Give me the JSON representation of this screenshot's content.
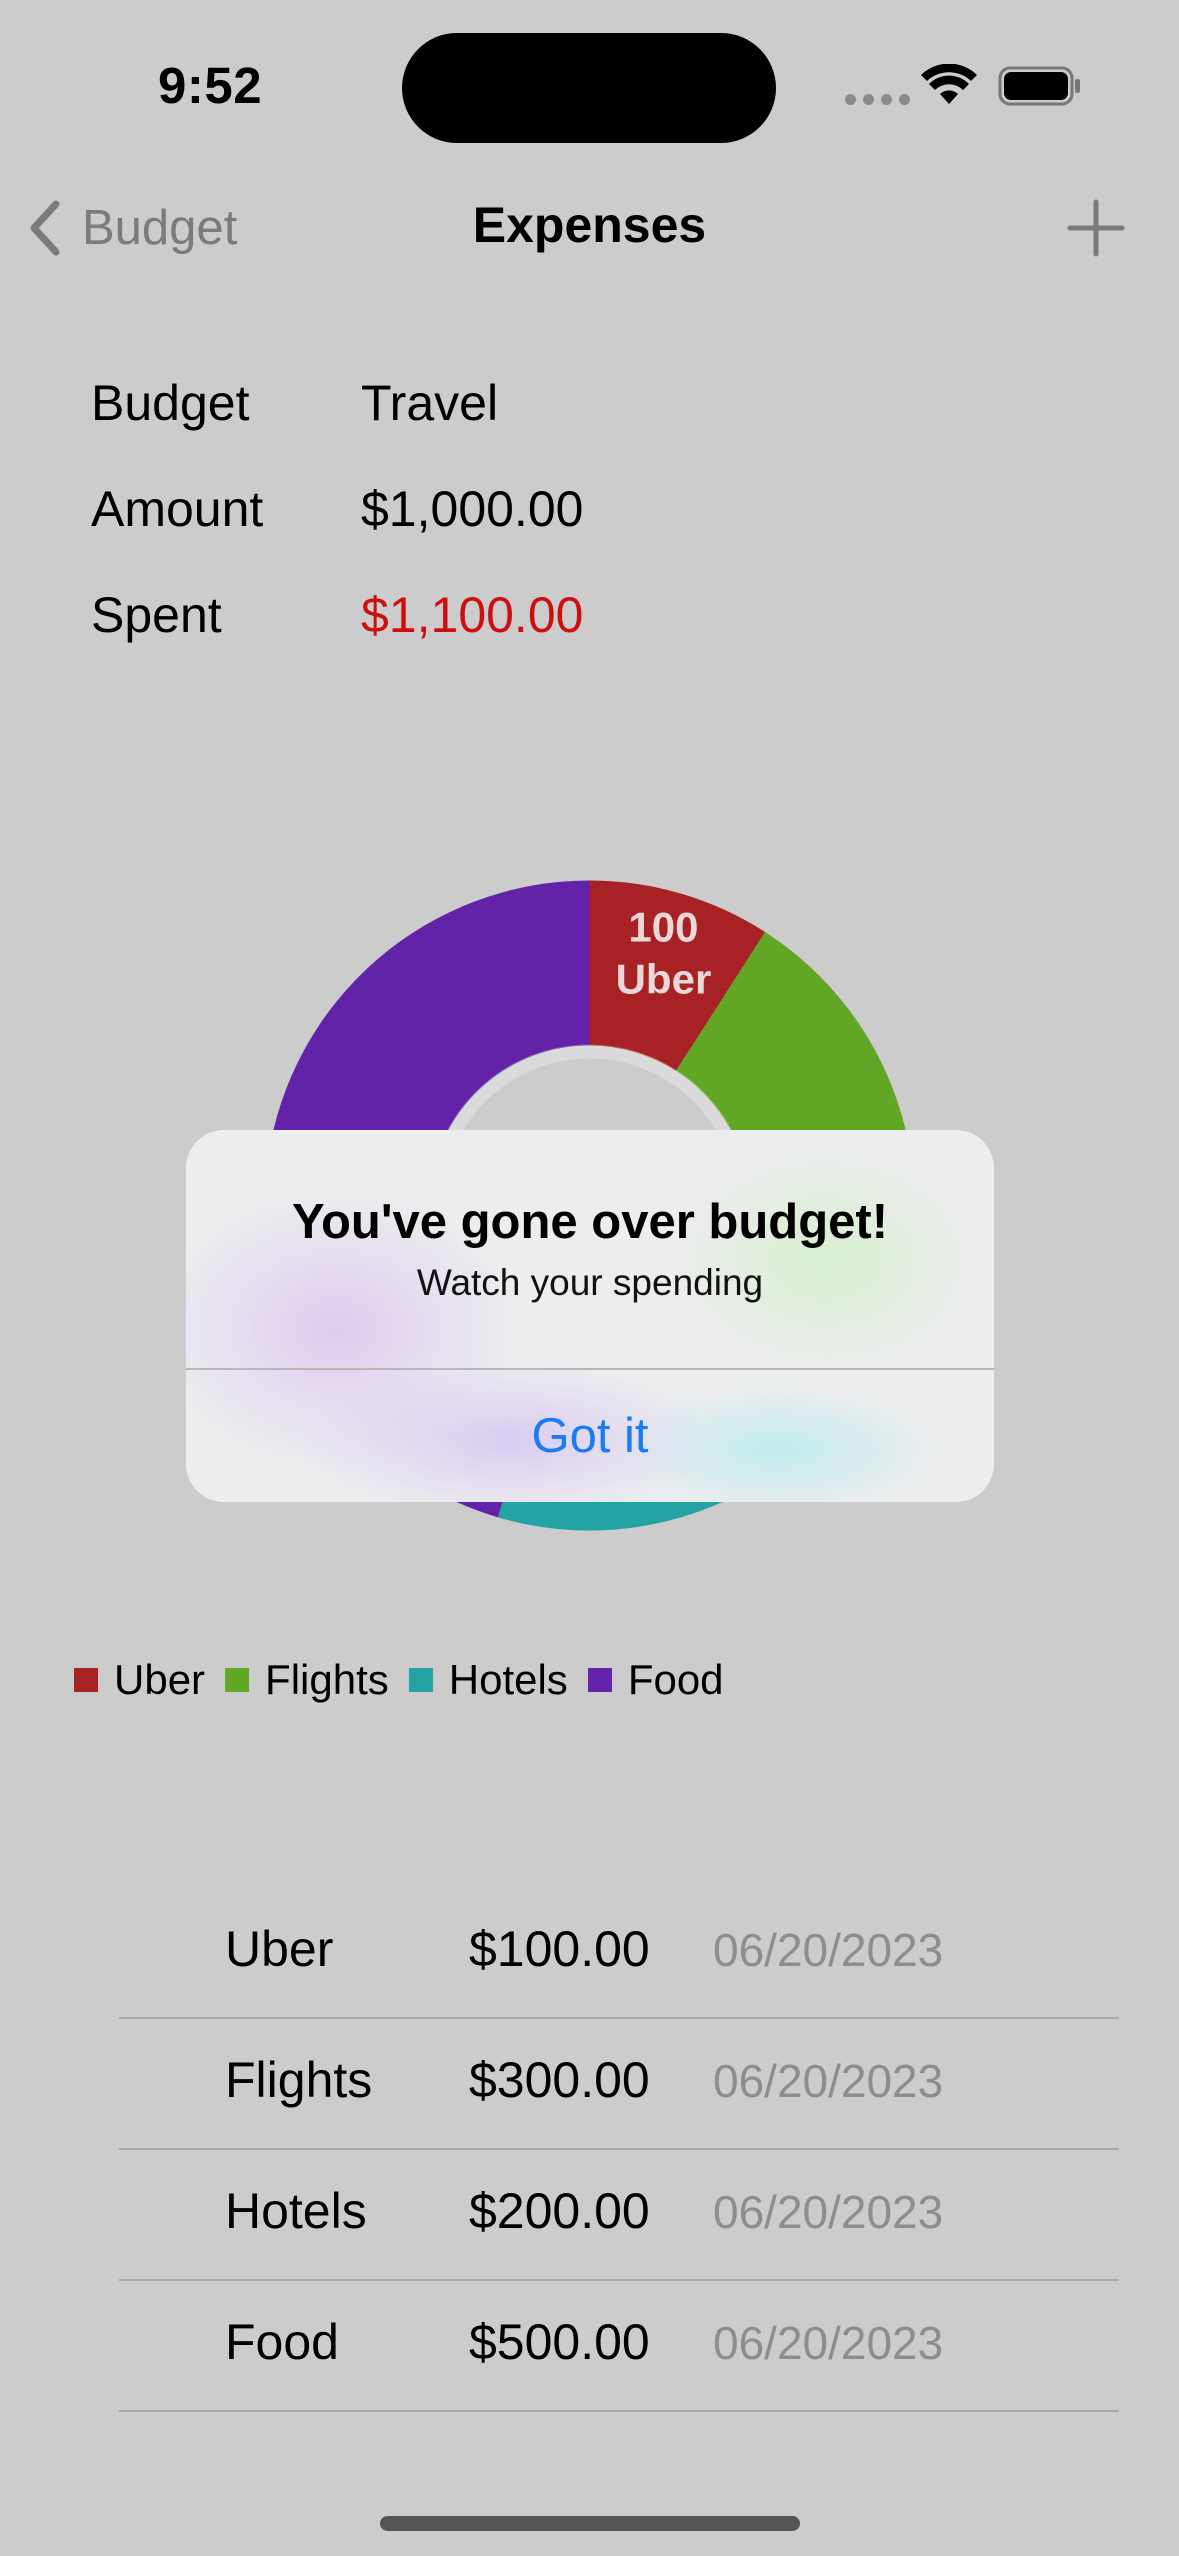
{
  "status_bar": {
    "time": "9:52"
  },
  "nav": {
    "back_label": "Budget",
    "title": "Expenses",
    "add_icon": "plus-icon"
  },
  "summary": {
    "rows": [
      {
        "label": "Budget",
        "value": "Travel"
      },
      {
        "label": "Amount",
        "value": "$1,000.00"
      },
      {
        "label": "Spent",
        "value": "$1,100.00"
      }
    ],
    "over_budget_color": "#cc1010"
  },
  "chart_data": {
    "type": "pie",
    "donut": true,
    "categories": [
      "Uber",
      "Flights",
      "Hotels",
      "Food"
    ],
    "values": [
      100,
      300,
      200,
      500
    ],
    "colors": [
      "#a82125",
      "#62a625",
      "#24a3a4",
      "#6323a8"
    ],
    "visible_slice_labels": [
      {
        "value": "100",
        "label": "Uber"
      }
    ],
    "legend_position": "bottom-left"
  },
  "legend": [
    {
      "label": "Uber",
      "color": "#a82125"
    },
    {
      "label": "Flights",
      "color": "#62a625"
    },
    {
      "label": "Hotels",
      "color": "#24a3a4"
    },
    {
      "label": "Food",
      "color": "#6323a8"
    }
  ],
  "expenses": [
    {
      "name": "Uber",
      "amount": "$100.00",
      "date": "06/20/2023"
    },
    {
      "name": "Flights",
      "amount": "$300.00",
      "date": "06/20/2023"
    },
    {
      "name": "Hotels",
      "amount": "$200.00",
      "date": "06/20/2023"
    },
    {
      "name": "Food",
      "amount": "$500.00",
      "date": "06/20/2023"
    }
  ],
  "alert": {
    "title": "You've gone over budget!",
    "message": "Watch your spending",
    "button_label": "Got it",
    "button_color": "#1a7cf2"
  }
}
